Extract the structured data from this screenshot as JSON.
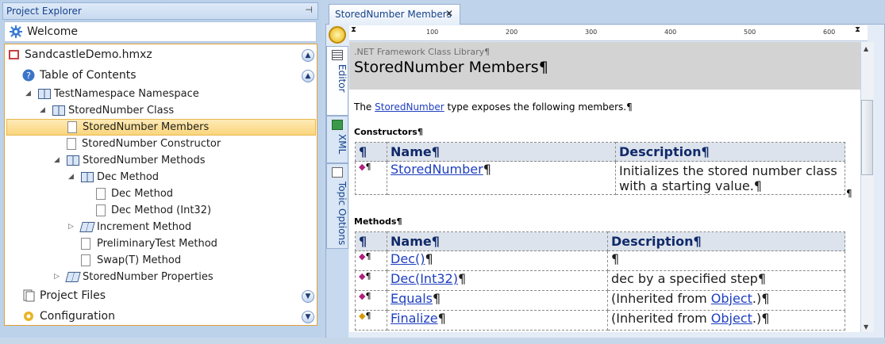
{
  "project_explorer": {
    "title": "Project Explorer",
    "pin_icon": "pin-icon",
    "welcome": "Welcome",
    "project": "SandcastleDemo.hmxz",
    "toc_label": "Table of Contents",
    "tree": [
      {
        "label": "TestNamespace Namespace"
      },
      {
        "label": "StoredNumber Class"
      },
      {
        "label": "StoredNumber Members",
        "selected": true
      },
      {
        "label": "StoredNumber Constructor"
      },
      {
        "label": "StoredNumber Methods"
      },
      {
        "label": "Dec Method"
      },
      {
        "label": "Dec Method"
      },
      {
        "label": "Dec Method (Int32)"
      },
      {
        "label": "Increment Method"
      },
      {
        "label": "PreliminaryTest Method"
      },
      {
        "label": "Swap(T) Method"
      },
      {
        "label": "StoredNumber Properties"
      }
    ],
    "project_files": "Project Files",
    "configuration": "Configuration"
  },
  "editor": {
    "tab_label": "StoredNumber Members",
    "close_symbol": "✕",
    "side_tabs": [
      "Editor",
      "XML",
      "Topic Options"
    ],
    "ruler": [
      "100",
      "200",
      "300",
      "400",
      "500",
      "600"
    ],
    "doc": {
      "library": ".NET Framework Class Library¶",
      "title": "StoredNumber Members¶",
      "intro_before": "The ",
      "intro_link": "StoredNumber",
      "intro_after": " type exposes the following members.¶",
      "constructors_heading": "Constructors¶",
      "methods_heading": "Methods¶",
      "col_icon": "¶",
      "col_name": "Name¶",
      "col_desc": "Description¶",
      "constructors": [
        {
          "icon": "¶",
          "name": "StoredNumber",
          "name_suffix": "¶",
          "desc": "Initializes the stored number class with a starting value.¶",
          "trail": "¶"
        }
      ],
      "methods": [
        {
          "icon": "¶",
          "name": "Dec()",
          "name_suffix": "¶",
          "desc_before": "¶",
          "desc_link": "",
          "desc_after": ""
        },
        {
          "icon": "¶",
          "name": "Dec(Int32)",
          "name_suffix": "¶",
          "desc_before": "dec by a specified step¶",
          "desc_link": "",
          "desc_after": ""
        },
        {
          "icon": "¶",
          "name": "Equals",
          "name_suffix": "¶",
          "desc_before": "(Inherited from ",
          "desc_link": "Object",
          "desc_after": ".)¶"
        },
        {
          "icon": "¶",
          "name": "Finalize",
          "name_suffix": "¶",
          "desc_before": "(Inherited from ",
          "desc_link": "Object",
          "desc_after": ".)¶"
        }
      ]
    }
  },
  "colors": {
    "selection": "#fad57c",
    "link": "#1f3fbf",
    "header_bg": "#dde3ec",
    "banner": "#d3d3d3"
  }
}
